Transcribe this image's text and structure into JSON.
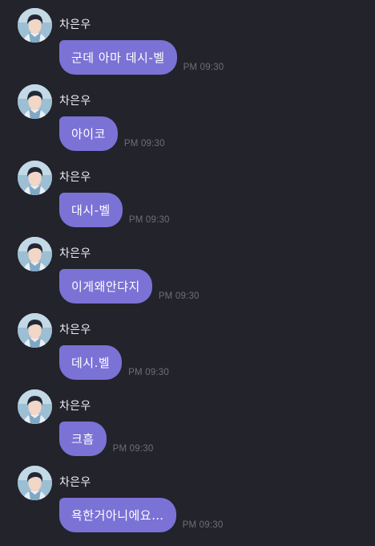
{
  "messages": [
    {
      "sender": "차은우",
      "text": "군데 아마 데시-벨",
      "time": "PM 09:30"
    },
    {
      "sender": "차은우",
      "text": "아이코",
      "time": "PM 09:30"
    },
    {
      "sender": "차은우",
      "text": "대시-벨",
      "time": "PM 09:30"
    },
    {
      "sender": "차은우",
      "text": "이게왜안댜지",
      "time": "PM 09:30"
    },
    {
      "sender": "차은우",
      "text": "데시.벨",
      "time": "PM 09:30"
    },
    {
      "sender": "차은우",
      "text": "크흠",
      "time": "PM 09:30"
    },
    {
      "sender": "차은우",
      "text": "욕한거아니에요…",
      "time": "PM 09:30"
    }
  ],
  "colors": {
    "background": "#23232b",
    "bubble": "#7b72d6",
    "bubble_text": "#ffffff",
    "timestamp": "#6e6e78",
    "sender": "#ededf2"
  },
  "icons": {
    "avatar": "profile-photo-avatar"
  }
}
